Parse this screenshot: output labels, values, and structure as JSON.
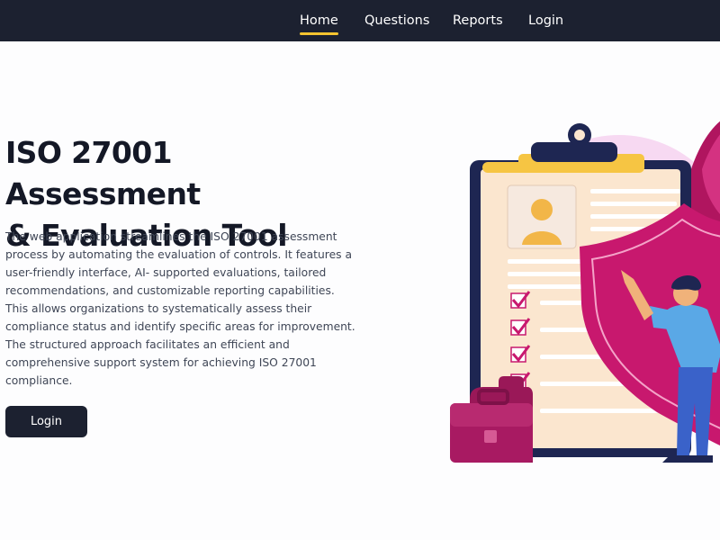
{
  "nav": {
    "items": [
      {
        "label": "Home",
        "active": true
      },
      {
        "label": "Questions",
        "active": false
      },
      {
        "label": "Reports",
        "active": false
      },
      {
        "label": "Login",
        "active": false
      }
    ]
  },
  "hero": {
    "title_line1": "ISO 27001 Assessment",
    "title_line2": "& Evaluation Tool",
    "description": "The web application streamlines the ISO 27001 assessment process by automating the evaluation of controls. It features a user-friendly interface, AI- supported evaluations, tailored recommendations, and customizable reporting capabilities. This allows organizations to systematically assess their compliance status and identify specific areas for improvement. The structured approach facilitates an efficient and comprehensive support system for achieving ISO 27001 compliance.",
    "cta_label": "Login"
  },
  "illustration": {
    "icons": [
      "clipboard-icon",
      "user-profile-icon",
      "checkmark-icon",
      "shield-icon",
      "briefcase-icon",
      "person-figure"
    ]
  },
  "colors": {
    "nav_background": "#1c2130",
    "nav_active_underline": "#f4c430",
    "heading": "#141826",
    "body_text": "#3f4656",
    "button_background": "#1c2130",
    "accent_magenta": "#c8186e"
  }
}
